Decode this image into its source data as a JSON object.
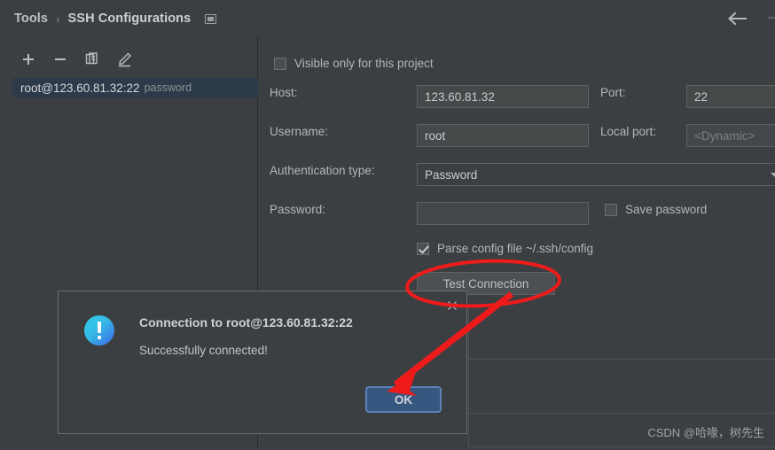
{
  "window": {
    "background_color": "#3c3f41",
    "accent_color": "#365880",
    "annotation_color": "#ef1b1b"
  },
  "header": {
    "breadcrumb": {
      "root": "Tools",
      "separator": "›",
      "current": "SSH Configurations"
    },
    "detach_icon": "window-icon",
    "back_icon": "back-arrow-icon"
  },
  "left_panel": {
    "toolbar": [
      {
        "name": "add",
        "icon": "plus-icon",
        "label": "+"
      },
      {
        "name": "remove",
        "icon": "minus-icon",
        "label": "−"
      },
      {
        "name": "copy",
        "icon": "copy-icon",
        "label": "❐"
      },
      {
        "name": "edit",
        "icon": "pencil-icon",
        "label": "✎"
      }
    ],
    "items": [
      {
        "title": "root@123.60.81.32:22",
        "subtitle": "password",
        "selected": true
      }
    ]
  },
  "form": {
    "visible_only_checkbox": {
      "label": "Visible only for this project",
      "checked": false
    },
    "host": {
      "label": "Host:",
      "value": "123.60.81.32"
    },
    "port": {
      "label": "Port:",
      "value": "22"
    },
    "username": {
      "label": "Username:",
      "value": "root"
    },
    "local_port": {
      "label": "Local port:",
      "value": "",
      "placeholder": "<Dynamic>"
    },
    "auth_type": {
      "label": "Authentication type:",
      "value": "Password"
    },
    "password": {
      "label": "Password:",
      "value": ""
    },
    "save_password": {
      "label": "Save password",
      "checked": false
    },
    "parse_config": {
      "label": "Parse config file ~/.ssh/config",
      "checked": true
    },
    "test_connection_button": "Test Connection"
  },
  "dialog": {
    "title": "Connection to root@123.60.81.32:22",
    "message": "Successfully connected!",
    "ok_button": "OK",
    "close_icon": "close-icon",
    "status_icon": "info-exclamation-icon"
  },
  "watermark": {
    "text": "CSDN @哈喙，树先生"
  }
}
